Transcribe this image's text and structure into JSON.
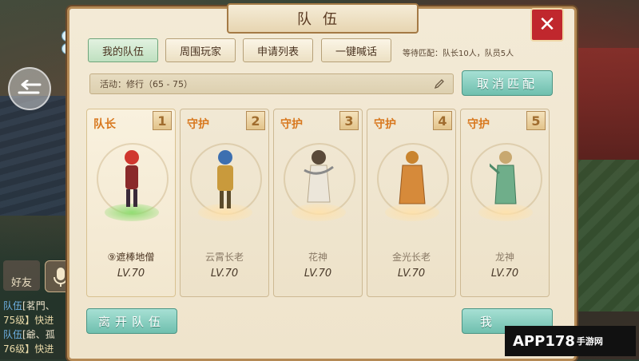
{
  "window": {
    "title": "队伍"
  },
  "tabs": [
    {
      "label": "我的队伍",
      "active": true
    },
    {
      "label": "周围玩家",
      "active": false
    },
    {
      "label": "申请列表",
      "active": false
    },
    {
      "label": "一键喊话",
      "active": false
    }
  ],
  "match_info": "等待匹配：队长10人，队员5人",
  "activity": {
    "value": "活动：修行（65 - 75）",
    "icon": "pencil-icon"
  },
  "cancel_match_label": "取消匹配",
  "members": [
    {
      "slot": "1",
      "role": "队长",
      "name": "⑨遮棒地僧",
      "level": "LV.70",
      "color": "#d0372e"
    },
    {
      "slot": "2",
      "role": "守护",
      "name": "云霄长老",
      "level": "LV.70",
      "color": "#3d6fb0"
    },
    {
      "slot": "3",
      "role": "守护",
      "name": "花神",
      "level": "LV.70",
      "color": "#e8e2d6"
    },
    {
      "slot": "4",
      "role": "守护",
      "name": "金光长老",
      "level": "LV.70",
      "color": "#c9842e"
    },
    {
      "slot": "5",
      "role": "守护",
      "name": "龙神",
      "level": "LV.70",
      "color": "#6fae8a"
    }
  ],
  "leave_team_label": "离开队伍",
  "right_button_label": "我",
  "side": {
    "friends_label": "好友",
    "chat_lines": [
      {
        "tag": "队伍",
        "text": "[茗門、"
      },
      {
        "tag": "",
        "text": "75级】快进"
      },
      {
        "tag": "队伍",
        "text": "[爺、孤"
      },
      {
        "tag": "",
        "text": "76级】快进"
      }
    ]
  },
  "watermark": {
    "main": "APP178",
    "sub": "手游网"
  }
}
